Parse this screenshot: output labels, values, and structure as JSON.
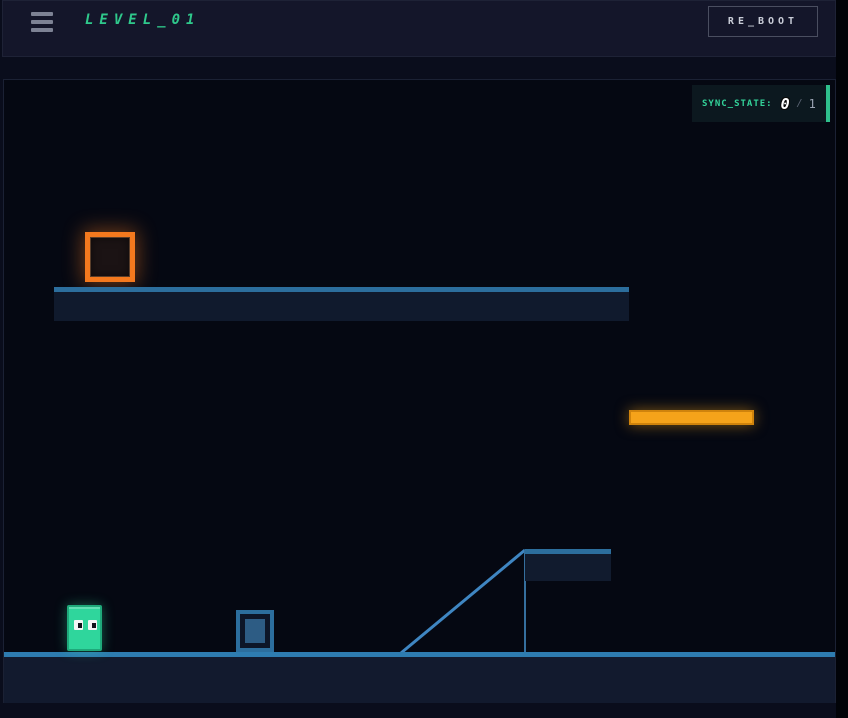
{
  "header": {
    "title": "LEVEL_01",
    "reboot_label": "RE_BOOT",
    "menu_icon": "hamburger-icon"
  },
  "hud": {
    "sync_label": "SYNC_STATE:",
    "sync_current": "0",
    "sync_separator": "/",
    "sync_total": "1"
  },
  "game": {
    "entities": [
      {
        "name": "goal-outline-square",
        "color": "#f4791e"
      },
      {
        "name": "upper-platform",
        "color": "#2c6e9d"
      },
      {
        "name": "orange-bar-platform",
        "color": "#f5a31a"
      },
      {
        "name": "ramp-slope",
        "color": "#3f86c2"
      },
      {
        "name": "ledge-platform",
        "color": "#2c6e9d"
      },
      {
        "name": "crate-box",
        "color": "#2c6e9d"
      },
      {
        "name": "player-character",
        "color": "#2fd69c"
      },
      {
        "name": "ground",
        "color": "#2e7cb0"
      }
    ]
  },
  "colors": {
    "accent_green": "#2fc98c",
    "accent_orange": "#f4791e",
    "bar_orange": "#f5a31a",
    "platform_blue": "#2c6e9d",
    "ground_blue": "#2e7cb0",
    "header_bg": "#14162a",
    "game_bg": "#050812"
  }
}
